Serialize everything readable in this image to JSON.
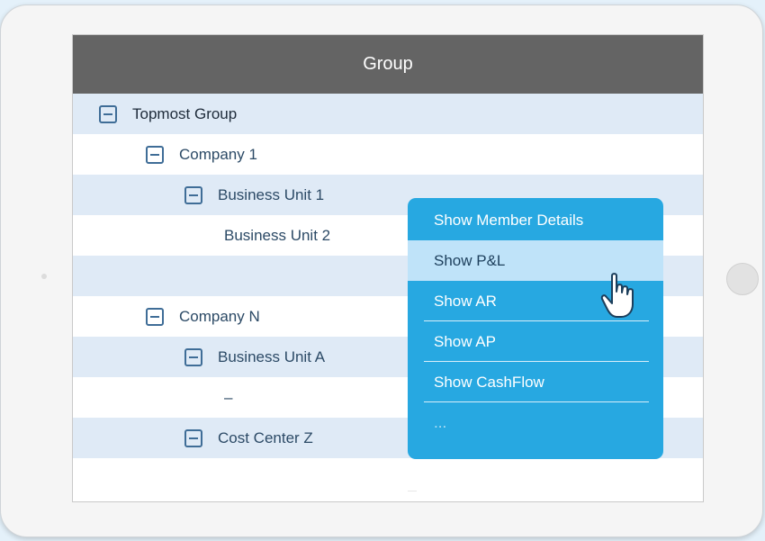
{
  "header": {
    "title": "Group"
  },
  "tree": {
    "rows": [
      {
        "label": "Topmost Group",
        "toggle": true
      },
      {
        "label": "Company 1",
        "toggle": true
      },
      {
        "label": "Business Unit 1",
        "toggle": true
      },
      {
        "label": "Business Unit 2",
        "toggle": false
      },
      {
        "label": "",
        "toggle": false
      },
      {
        "label": "Company N",
        "toggle": true
      },
      {
        "label": "Business Unit A",
        "toggle": true
      },
      {
        "label": "–",
        "toggle": false
      },
      {
        "label": "Cost Center Z",
        "toggle": true
      },
      {
        "label": "",
        "toggle": false
      }
    ]
  },
  "context_menu": {
    "items": [
      {
        "label": "Show Member Details"
      },
      {
        "label": "Show P&L",
        "state": "hovered"
      },
      {
        "label": "Show AR"
      },
      {
        "label": "Show AP"
      },
      {
        "label": "Show CashFlow"
      },
      {
        "label": "..."
      }
    ]
  },
  "colors": {
    "header_bg": "#646464",
    "row_shade": "#dfeaf6",
    "menu_bg": "#27a8e1",
    "menu_hover": "#bfe3f9",
    "page_bg": "#e4f1fa"
  },
  "icons": {
    "toggle": "minus-square-icon",
    "cursor": "hand-pointer-icon"
  }
}
